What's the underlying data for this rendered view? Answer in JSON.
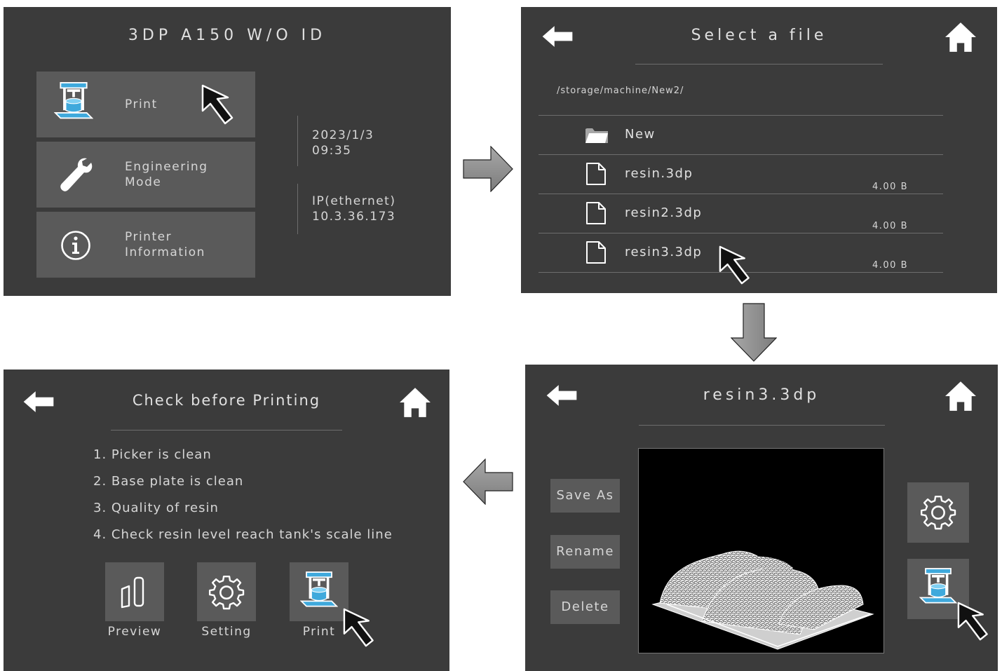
{
  "screen_main": {
    "title": "3DP A150 W/O ID",
    "menu": [
      {
        "label": "Print",
        "icon": "printer-icon"
      },
      {
        "label": "Engineering\nMode",
        "icon": "wrench-icon"
      },
      {
        "label": "Printer\nInformation",
        "icon": "info-icon"
      }
    ],
    "date": "2023/1/3",
    "time": "09:35",
    "ip_label": "IP(ethernet)",
    "ip_value": "10.3.36.173"
  },
  "screen_files": {
    "title": "Select a file",
    "path": "/storage/machine/New2/",
    "items": [
      {
        "name": "New",
        "type": "folder",
        "size": ""
      },
      {
        "name": "resin.3dp",
        "type": "file",
        "size": "4.00 B"
      },
      {
        "name": "resin2.3dp",
        "type": "file",
        "size": "4.00 B"
      },
      {
        "name": "resin3.3dp",
        "type": "file",
        "size": "4.00 B"
      }
    ]
  },
  "screen_preview": {
    "title": "resin3.3dp",
    "buttons": {
      "save_as": "Save As",
      "rename": "Rename",
      "delete": "Delete"
    }
  },
  "screen_check": {
    "title": "Check before Printing",
    "items": [
      "1. Picker is clean",
      "2. Base plate is clean",
      "3. Quality of resin",
      "4. Check resin level reach tank's scale line"
    ],
    "actions": {
      "preview": "Preview",
      "setting": "Setting",
      "print": "Print"
    }
  },
  "colors": {
    "panel_bg": "#3b3b3b",
    "tile_bg": "#5a5a5a",
    "accent_blue": "#3fa9dc",
    "text": "#d6d6d6"
  }
}
